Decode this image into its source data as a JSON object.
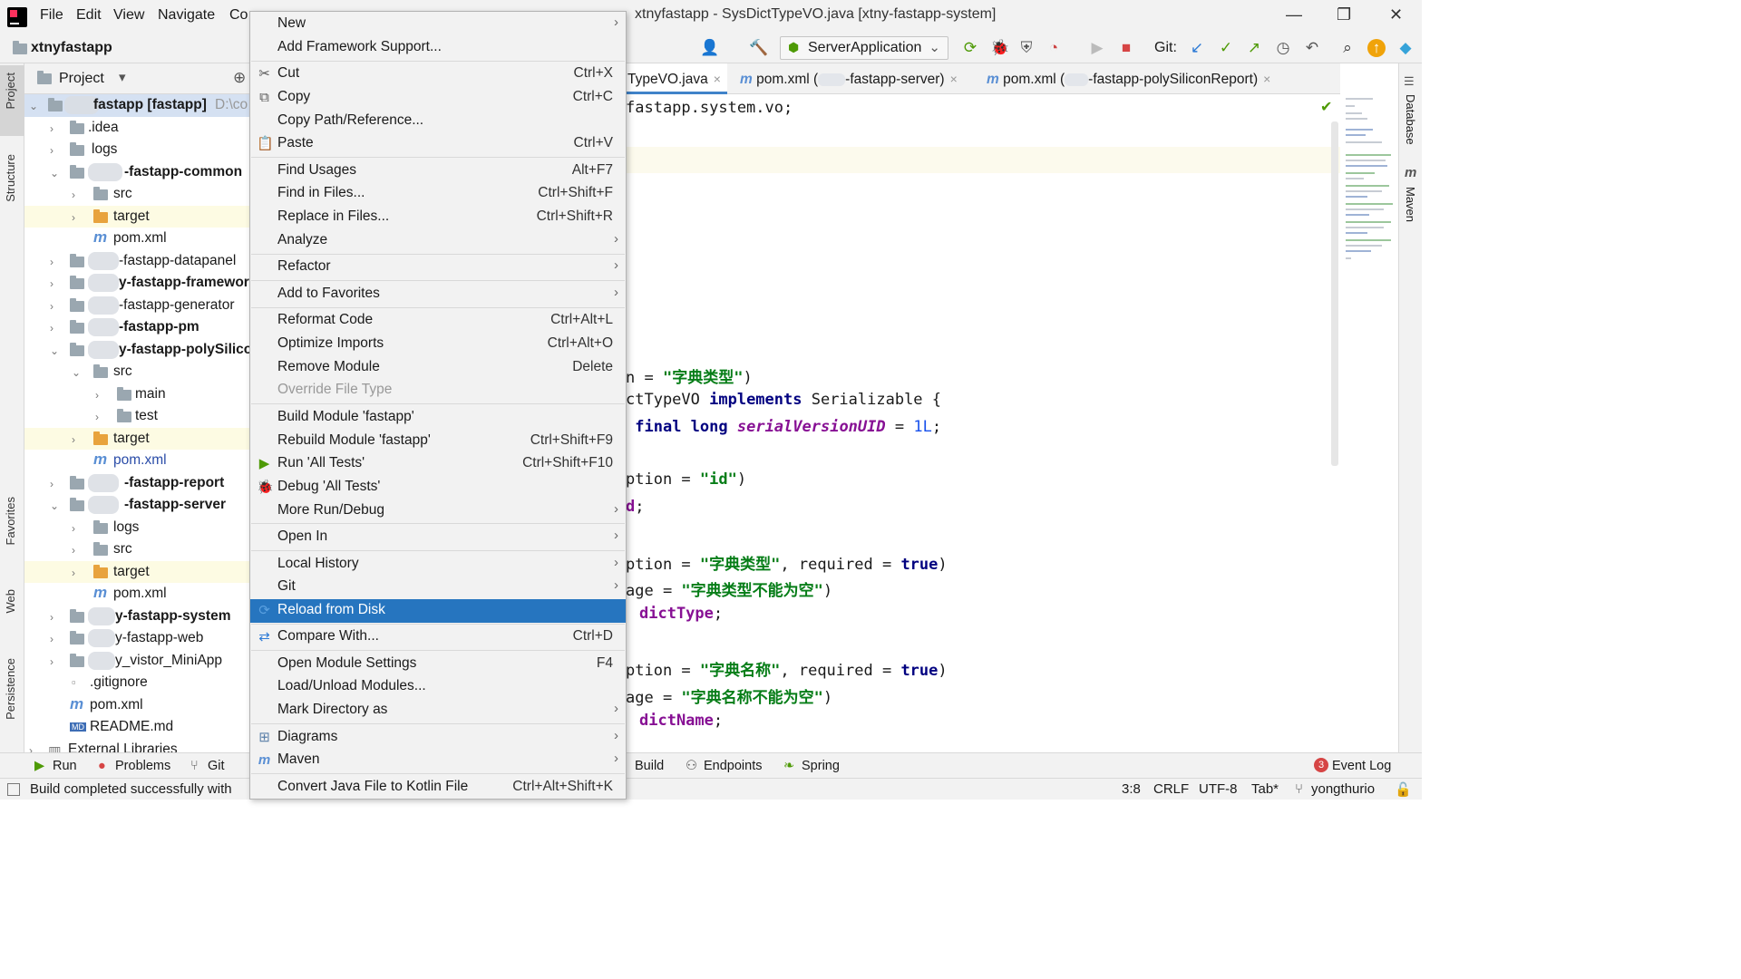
{
  "window": {
    "title": "xtnyfastapp - SysDictTypeVO.java [xtny-fastapp-system]",
    "menu": [
      "File",
      "Edit",
      "View",
      "Navigate",
      "Co"
    ],
    "controls": [
      "minimize",
      "restore",
      "close"
    ]
  },
  "navbar": {
    "project_name": "xtnyfastapp",
    "run_config": "ServerApplication",
    "git_label": "Git:"
  },
  "left_stripe": [
    "Project",
    "Structure",
    "Favorites",
    "Web",
    "Persistence"
  ],
  "right_stripe": [
    "Database",
    "Maven"
  ],
  "project_panel": {
    "header": "Project",
    "tree": [
      {
        "label": "fastapp [fastapp]",
        "suffix": "D:\\co",
        "bold": true
      },
      {
        "label": ".idea"
      },
      {
        "label": "logs"
      },
      {
        "label": "-fastapp-common",
        "bold": true
      },
      {
        "label": "src"
      },
      {
        "label": "target"
      },
      {
        "label": "pom.xml"
      },
      {
        "label": "-fastapp-datapanel"
      },
      {
        "label": "y-fastapp-framework",
        "bold": true
      },
      {
        "label": "-fastapp-generator"
      },
      {
        "label": "-fastapp-pm",
        "bold": true
      },
      {
        "label": "y-fastapp-polySilicon",
        "bold": true
      },
      {
        "label": "src"
      },
      {
        "label": "main"
      },
      {
        "label": "test"
      },
      {
        "label": "target"
      },
      {
        "label": "pom.xml"
      },
      {
        "label": "-fastapp-report",
        "bold": true
      },
      {
        "label": "-fastapp-server",
        "bold": true
      },
      {
        "label": "logs"
      },
      {
        "label": "src"
      },
      {
        "label": "target"
      },
      {
        "label": "pom.xml"
      },
      {
        "label": "y-fastapp-system",
        "bold": true
      },
      {
        "label": "y-fastapp-web"
      },
      {
        "label": "y_vistor_MiniApp"
      },
      {
        "label": ".gitignore"
      },
      {
        "label": "pom.xml"
      },
      {
        "label": "README.md"
      },
      {
        "label": "External Libraries"
      }
    ]
  },
  "editor": {
    "tabs": [
      {
        "label": "TypeVO.java",
        "close": "×"
      },
      {
        "label": "pom.xml (",
        "tail": "-fastapp-server)",
        "close": "×"
      },
      {
        "label": "pom.xml (",
        "tail": "-fastapp-polySiliconReport)",
        "close": "×"
      }
    ],
    "lines": {
      "l1": "fastapp.system.vo;",
      "l2a": "n = ",
      "l2b": "\"字典类型\"",
      "l2c": ")",
      "l3a": "ctTypeVO ",
      "l3b": "implements",
      "l3c": " Serializable {",
      "l4a": " ",
      "l4b": "final long",
      "l4c": " ",
      "l4d": "serialVersionUID",
      "l4e": " = ",
      "l4f": "1L",
      "l4g": ";",
      "l5a": "ption = ",
      "l5b": "\"id\"",
      "l5c": ")",
      "l6a": "d",
      "l6b": ";",
      "l7a": "ption = ",
      "l7b": "\"字典类型\"",
      "l7c": ", required = ",
      "l7d": "true",
      "l7e": ")",
      "l8a": "age = ",
      "l8b": "\"字典类型不能为空\"",
      "l8c": ")",
      "l9a": "dictType",
      "l9b": ";",
      "l10a": "ption = ",
      "l10b": "\"字典名称\"",
      "l10c": ", required = ",
      "l10d": "true",
      "l10e": ")",
      "l11a": "age = ",
      "l11b": "\"字典名称不能为空\"",
      "l11c": ")",
      "l12a": "dictName",
      "l12b": ";"
    }
  },
  "context_menu": {
    "items": [
      {
        "label": "New",
        "submenu": true
      },
      {
        "label": "Add Framework Support..."
      },
      {
        "label": "Cut",
        "shortcut": "Ctrl+X",
        "icon": "scissors-icon"
      },
      {
        "label": "Copy",
        "shortcut": "Ctrl+C",
        "icon": "copy-icon"
      },
      {
        "label": "Copy Path/Reference..."
      },
      {
        "label": "Paste",
        "shortcut": "Ctrl+V",
        "icon": "paste-icon"
      },
      {
        "label": "Find Usages",
        "shortcut": "Alt+F7"
      },
      {
        "label": "Find in Files...",
        "shortcut": "Ctrl+Shift+F"
      },
      {
        "label": "Replace in Files...",
        "shortcut": "Ctrl+Shift+R"
      },
      {
        "label": "Analyze",
        "submenu": true
      },
      {
        "label": "Refactor",
        "submenu": true
      },
      {
        "label": "Add to Favorites",
        "submenu": true
      },
      {
        "label": "Reformat Code",
        "shortcut": "Ctrl+Alt+L"
      },
      {
        "label": "Optimize Imports",
        "shortcut": "Ctrl+Alt+O"
      },
      {
        "label": "Remove Module",
        "shortcut": "Delete"
      },
      {
        "label": "Override File Type",
        "disabled": true
      },
      {
        "label": "Build Module 'fastapp'"
      },
      {
        "label": "Rebuild Module 'fastapp'",
        "shortcut": "Ctrl+Shift+F9"
      },
      {
        "label": "Run 'All Tests'",
        "shortcut": "Ctrl+Shift+F10",
        "icon": "run-icon"
      },
      {
        "label": "Debug 'All Tests'",
        "icon": "debug-icon"
      },
      {
        "label": "More Run/Debug",
        "submenu": true
      },
      {
        "label": "Open In",
        "submenu": true
      },
      {
        "label": "Local History",
        "submenu": true
      },
      {
        "label": "Git",
        "submenu": true
      },
      {
        "label": "Reload from Disk",
        "active": true,
        "icon": "reload-icon"
      },
      {
        "label": "Compare With...",
        "shortcut": "Ctrl+D",
        "icon": "compare-icon"
      },
      {
        "label": "Open Module Settings",
        "shortcut": "F4"
      },
      {
        "label": "Load/Unload Modules..."
      },
      {
        "label": "Mark Directory as",
        "submenu": true
      },
      {
        "label": "Diagrams",
        "submenu": true,
        "icon": "diagram-icon"
      },
      {
        "label": "Maven",
        "submenu": true,
        "icon": "maven-icon"
      },
      {
        "label": "Convert Java File to Kotlin File",
        "shortcut": "Ctrl+Alt+Shift+K"
      }
    ]
  },
  "bottom_bar": {
    "left": [
      "Run",
      "Problems",
      "Git"
    ],
    "right": [
      "Build",
      "Endpoints",
      "Spring"
    ],
    "event_log": "Event Log",
    "event_count": "3"
  },
  "status_bar": {
    "message": "Build completed successfully with",
    "position": "3:8",
    "line_sep": "CRLF",
    "encoding": "UTF-8",
    "indent": "Tab*",
    "branch": "yongthurio"
  },
  "colors": {
    "menu_active": "#2675bf",
    "keyword": "#000080",
    "string": "#067d17",
    "number": "#1750eb",
    "field": "#871094"
  }
}
